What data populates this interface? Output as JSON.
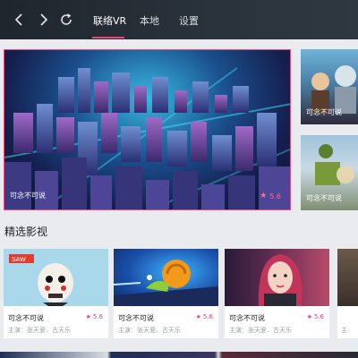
{
  "header": {
    "tabs": [
      {
        "label": "联络VR",
        "active": true
      },
      {
        "label": "本地",
        "active": false
      },
      {
        "label": "设置",
        "active": false
      }
    ],
    "icons": [
      "back-icon",
      "forward-icon",
      "refresh-icon"
    ],
    "accent_color": "#e8437a"
  },
  "hero": {
    "title": "可念不可说",
    "rating": "5.6"
  },
  "side_cards": [
    {
      "title": "可念不可说"
    },
    {
      "title": "可念不可说"
    }
  ],
  "section": {
    "title": "精选影视"
  },
  "movies": [
    {
      "title": "可念不可说",
      "rating": "5.6",
      "cast": "主演：张天爱、古天乐"
    },
    {
      "title": "可念不可说",
      "rating": "5.6",
      "cast": "主演：张天爱、古天乐"
    },
    {
      "title": "可念不可说",
      "rating": "5.6",
      "cast": "主演：张天爱、古天乐"
    }
  ],
  "partial_card": {
    "cast": "主"
  }
}
